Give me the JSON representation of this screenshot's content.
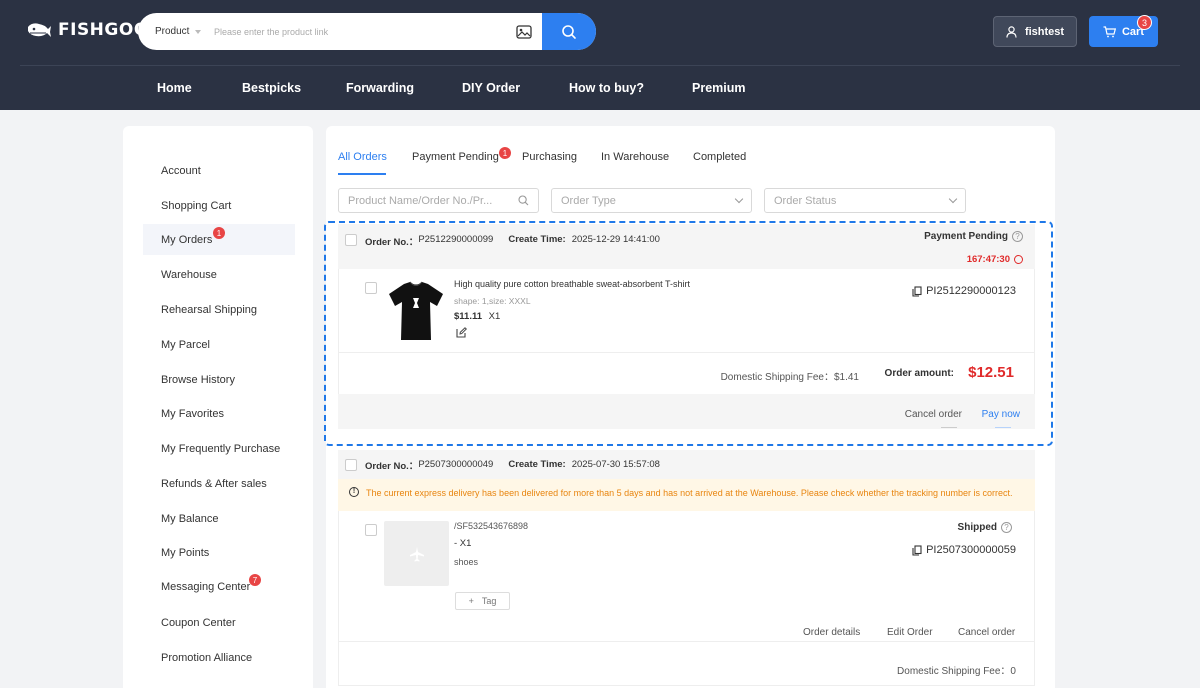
{
  "header": {
    "logo_text": "FISHGOO",
    "search": {
      "type": "Product",
      "placeholder": "Please enter the product link"
    },
    "user": "fishtest",
    "cart": {
      "label": "Cart",
      "count": "3"
    },
    "nav": [
      "Home",
      "Bestpicks",
      "Forwarding",
      "DIY Order",
      "How to buy?",
      "Premium"
    ]
  },
  "sidebar": {
    "items": [
      {
        "label": "Account"
      },
      {
        "label": "Shopping Cart"
      },
      {
        "label": "My Orders",
        "badge": "1"
      },
      {
        "label": "Warehouse"
      },
      {
        "label": "Rehearsal Shipping"
      },
      {
        "label": "My Parcel"
      },
      {
        "label": "Browse History"
      },
      {
        "label": "My Favorites"
      },
      {
        "label": "My Frequently Purchase"
      },
      {
        "label": "Refunds & After sales"
      },
      {
        "label": "My Balance"
      },
      {
        "label": "My Points"
      },
      {
        "label": "Messaging Center",
        "badge": "7"
      },
      {
        "label": "Coupon Center"
      },
      {
        "label": "Promotion Alliance"
      }
    ]
  },
  "main": {
    "tabs": [
      {
        "label": "All Orders"
      },
      {
        "label": "Payment Pending",
        "badge": "1"
      },
      {
        "label": "Purchasing"
      },
      {
        "label": "In Warehouse"
      },
      {
        "label": "Completed"
      }
    ],
    "filters": {
      "search_placeholder": "Product Name/Order No./Pr...",
      "order_type": "Order Type",
      "order_status": "Order Status"
    }
  },
  "orders": [
    {
      "order_no_label": "Order No.：",
      "order_no": "P2512290000099",
      "create_time_label": "Create Time:",
      "create_time": "2025-12-29 14:41:00",
      "status": "Payment Pending",
      "timer": "167:47:30",
      "item_title": "High quality pure cotton breathable sweat-absorbent T-shirt",
      "item_spec": "shape: 1,size: XXXL",
      "item_price": "$11.11",
      "item_qty": "X1",
      "item_code": "PI2512290000123",
      "shipping_fee_label": "Domestic Shipping Fee：$1.41",
      "order_amount_label": "Order amount:",
      "order_amount": "$12.51",
      "actions": [
        "Cancel order",
        "Pay now"
      ]
    },
    {
      "order_no_label": "Order No.：",
      "order_no": "P2507300000049",
      "create_time_label": "Create Time:",
      "create_time": "2025-07-30 15:57:08",
      "warning": "The current express delivery has been delivered for more than 5 days and has not arrived at the Warehouse. Please check whether the tracking number is correct.",
      "item_tracking": "/SF532543676898",
      "item_line": "-  X1",
      "item_note": "shoes",
      "tag_label": "Tag",
      "status": "Shipped",
      "item_code": "PI2507300000059",
      "actions": [
        "Order details",
        "Edit Order",
        "Cancel order"
      ],
      "shipping_fee_label": "Domestic Shipping Fee：0"
    }
  ],
  "colors": {
    "header_bg": "#2b3243",
    "accent": "#2d7ff0",
    "danger": "#e02a2a",
    "warning": "#e8850f"
  }
}
